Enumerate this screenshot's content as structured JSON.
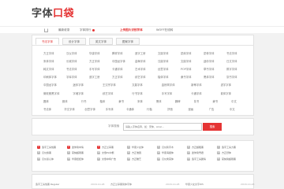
{
  "logo": {
    "main": "字体",
    "accent": "口袋"
  },
  "nav": {
    "items": [
      "最新收录",
      "字体排行",
      "上传图片识别字体",
      "WOFF在线转"
    ],
    "active_index": 2
  },
  "tabs": [
    "书法字体",
    "设计字体",
    "英文字体",
    "图案字体"
  ],
  "font_rows": [
    [
      "方正字体",
      "汉仪字体",
      "华康字体",
      "腾祥字体",
      "造字工房",
      "文鼎字体",
      "蒙纳字体",
      "蒙奇字体",
      "书法字体"
    ],
    [
      "宋体字体",
      "长城字体",
      "方正字体",
      "中国龙字体",
      "金梅字体",
      "汉鼎字体",
      "文鼎字体",
      "迷你字体",
      "日文字体"
    ],
    [
      "韩文字体",
      "书法字体",
      "手写字体",
      "卡通字体",
      "艺术字体",
      "创意字体",
      "POP字体",
      "草书字体",
      "胖字字体"
    ],
    [
      "印刷体字体",
      "字库字体",
      "造字工房",
      "方正字体",
      "综艺字体",
      "楷体字体",
      "隶书字体",
      "黑体字体",
      "篆书字体"
    ],
    [
      "中国龙字体",
      "迷你字体",
      "王汉宗字体",
      "文鼎字体",
      "金桥简字体",
      "新蒂字体",
      "锐字字体"
    ],
    [
      "微软雅黑字体",
      "字魂字体",
      "综艺字体",
      "行书字体",
      "手写字体",
      "卡通字体",
      "繁体字体"
    ],
    [
      "圆体",
      "颜体",
      "行书",
      "楷体",
      "隶书",
      "宋体",
      "黑体",
      "魏碑",
      "篆书",
      "隶书",
      "中文"
    ],
    [
      "书法体",
      "华文字体",
      "创意字体",
      "手写体",
      "卡通体",
      "行楷",
      "拼音",
      "漫画",
      "广告",
      "中文"
    ]
  ],
  "search": {
    "label": "字体搜索",
    "placeholder": "请输入字体名称，如：宋体、Arial...",
    "button": "搜索"
  },
  "rank_items": [
    "造字工房悦黑",
    "迷你简中倩",
    "方正兰亭黑",
    "华康少女体",
    "汉仪铸字木",
    "方正超粗黑",
    "造字工房力黑",
    "汉仪旗黑",
    "蒙纳超刚黑",
    "文鼎PL中楷",
    "方正准圆",
    "华康海报体",
    "迷你简雪君",
    "方正舒体",
    "汉仪菱心体",
    "华康娃娃体",
    "文鼎中特广告",
    "方正稚艺",
    "汉仪秀英体",
    "造字工房朗倩",
    "蒙纳简超刚黑"
  ],
  "list_rows": [
    {
      "name": "造字工房悦黑 Regular",
      "date": "2018-10-28"
    },
    {
      "name": "方正兰亭黑简体字体",
      "date": "2018-10-28"
    },
    {
      "name": "华康少女文字W5",
      "date": "2018-10-28"
    }
  ]
}
